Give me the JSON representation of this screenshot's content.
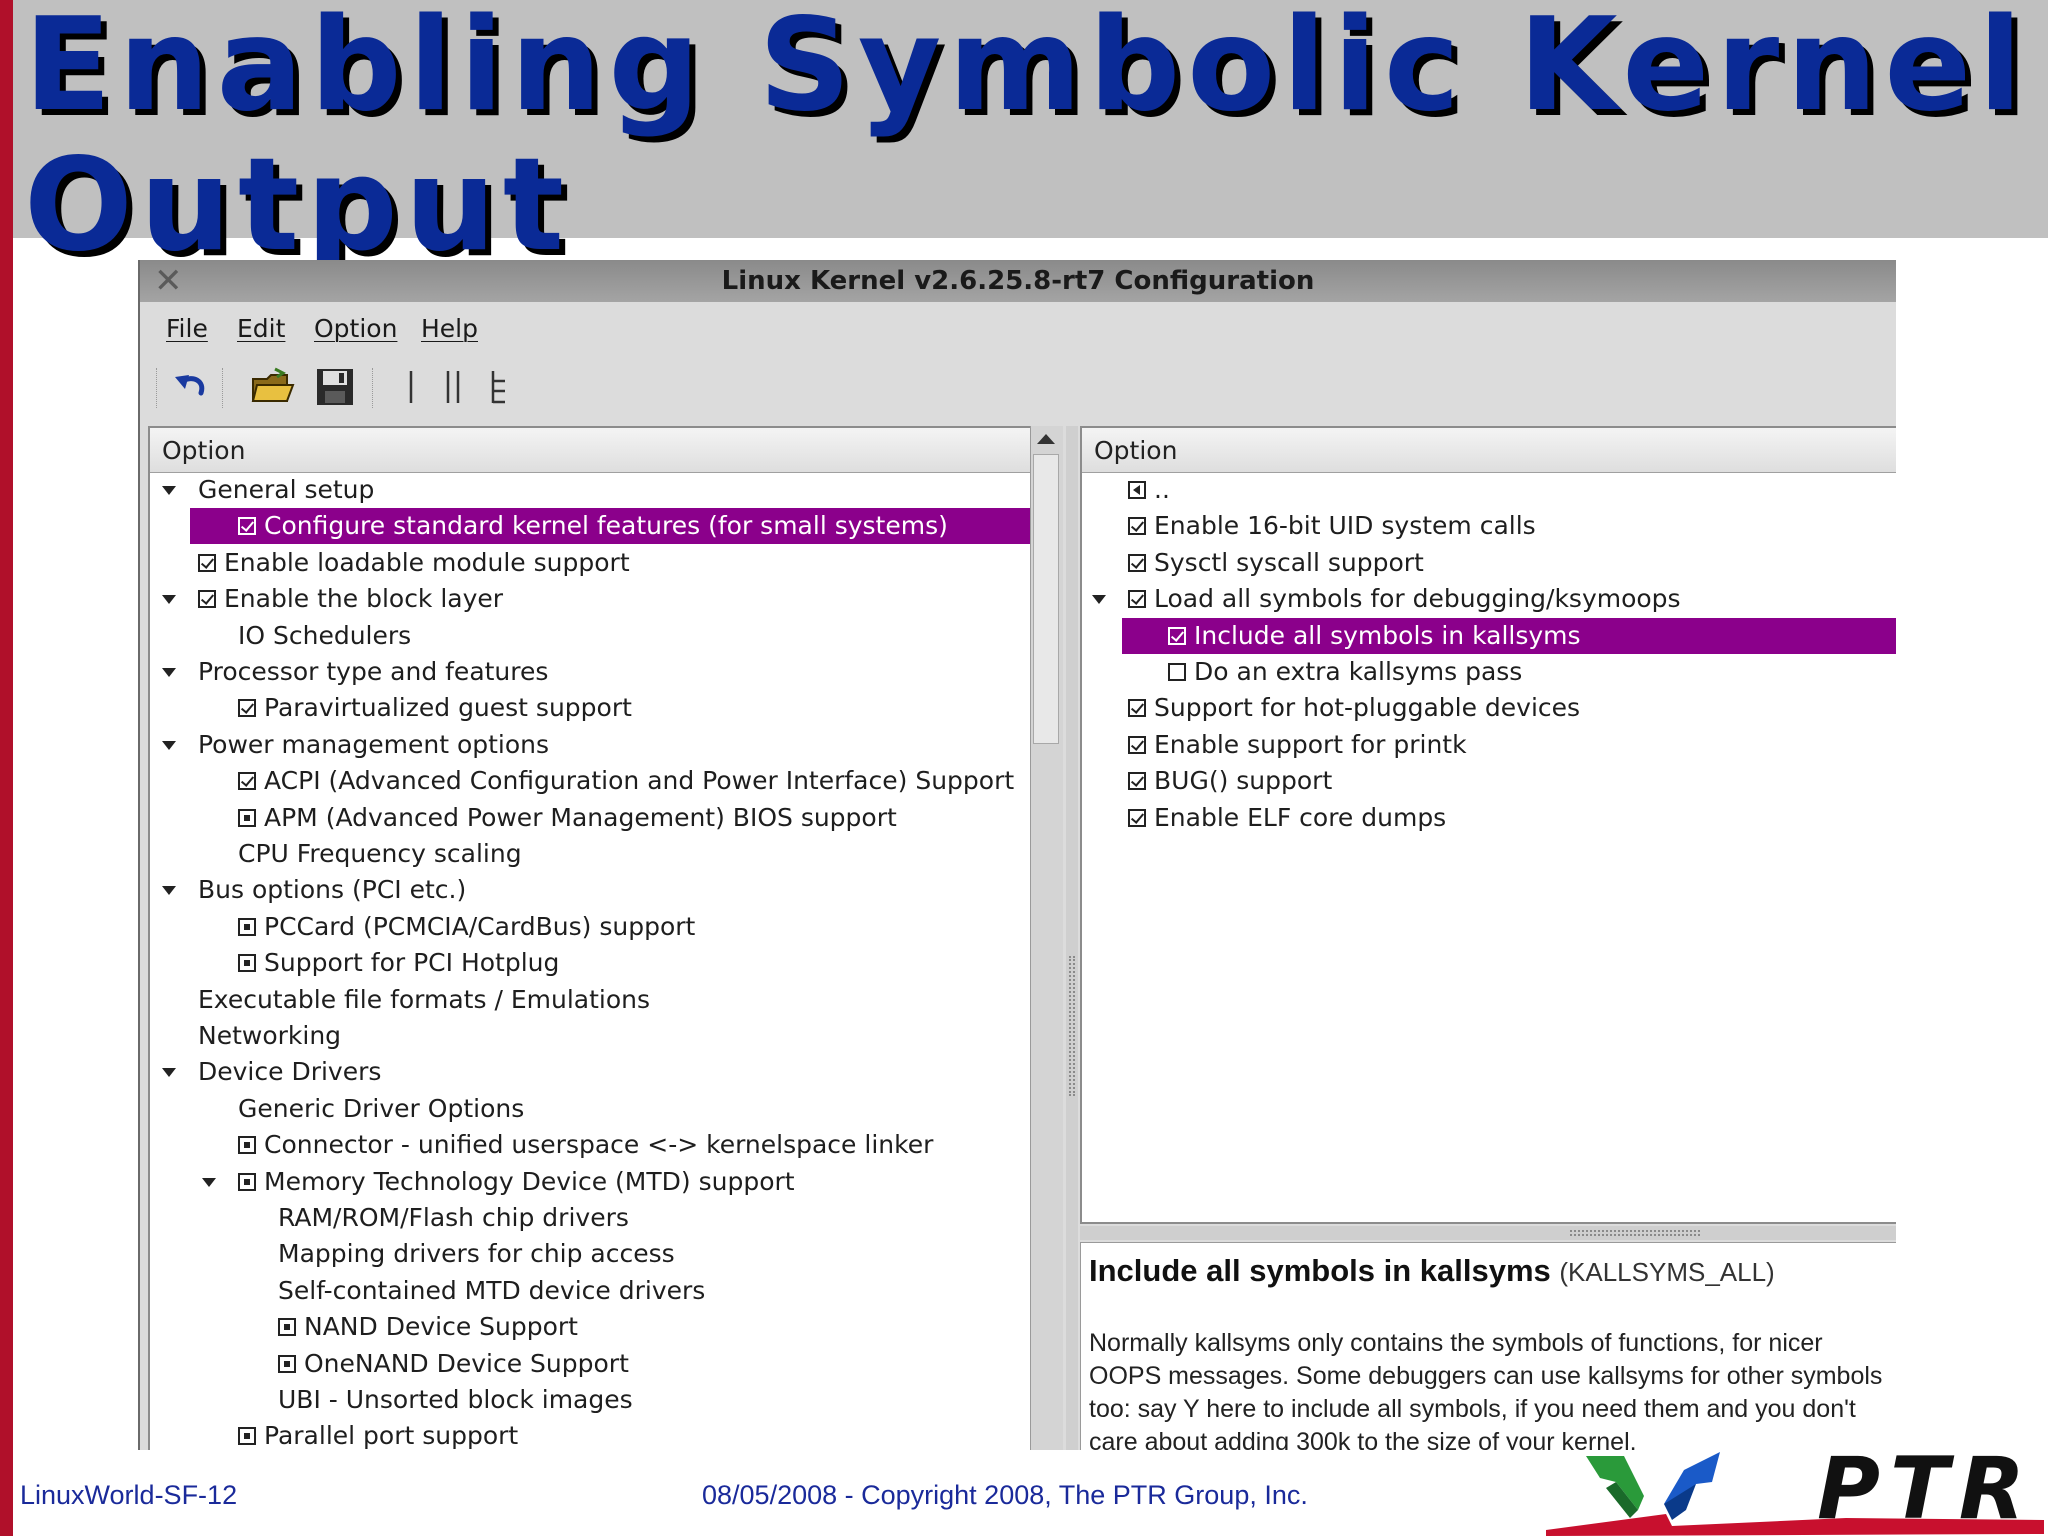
{
  "slide": {
    "title_line1": "Enabling Symbolic Kernel",
    "title_line2": "Output"
  },
  "window": {
    "title": "Linux Kernel v2.6.25.8-rt7 Configuration",
    "menu": [
      "File",
      "Edit",
      "Option",
      "Help"
    ],
    "toolbar": [
      "undo-icon",
      "open-folder-icon",
      "save-icon",
      "single-view-icon",
      "split-view-icon",
      "full-tree-view-icon"
    ]
  },
  "left_pane": {
    "header": "Option",
    "rows": [
      {
        "label": "General setup",
        "arrow": true,
        "mark": "none",
        "level": 0
      },
      {
        "label": "Configure standard kernel features (for small systems)",
        "arrow": false,
        "mark": "check",
        "level": 1,
        "selected": true
      },
      {
        "label": "Enable loadable module support",
        "arrow": false,
        "mark": "check",
        "level": 0
      },
      {
        "label": "Enable the block layer",
        "arrow": true,
        "mark": "check",
        "level": 0
      },
      {
        "label": "IO Schedulers",
        "arrow": false,
        "mark": "none",
        "level": 1
      },
      {
        "label": "Processor type and features",
        "arrow": true,
        "mark": "none",
        "level": 0
      },
      {
        "label": "Paravirtualized guest support",
        "arrow": false,
        "mark": "check",
        "level": 1
      },
      {
        "label": "Power management options",
        "arrow": true,
        "mark": "none",
        "level": 0
      },
      {
        "label": "ACPI (Advanced Configuration and Power Interface) Support",
        "arrow": false,
        "mark": "check",
        "level": 1
      },
      {
        "label": "APM (Advanced Power Management) BIOS support",
        "arrow": false,
        "mark": "module",
        "level": 1
      },
      {
        "label": "CPU Frequency scaling",
        "arrow": false,
        "mark": "none",
        "level": 1
      },
      {
        "label": "Bus options (PCI etc.)",
        "arrow": true,
        "mark": "none",
        "level": 0
      },
      {
        "label": "PCCard (PCMCIA/CardBus) support",
        "arrow": false,
        "mark": "module",
        "level": 1
      },
      {
        "label": "Support for PCI Hotplug",
        "arrow": false,
        "mark": "module",
        "level": 1
      },
      {
        "label": "Executable file formats / Emulations",
        "arrow": false,
        "mark": "none",
        "level": 0
      },
      {
        "label": "Networking",
        "arrow": false,
        "mark": "none",
        "level": 0
      },
      {
        "label": "Device Drivers",
        "arrow": true,
        "mark": "none",
        "level": 0
      },
      {
        "label": "Generic Driver Options",
        "arrow": false,
        "mark": "none",
        "level": 1
      },
      {
        "label": "Connector - unified userspace <-> kernelspace linker",
        "arrow": false,
        "mark": "module",
        "level": 1
      },
      {
        "label": "Memory Technology Device (MTD) support",
        "arrow": true,
        "mark": "module",
        "level": 1
      },
      {
        "label": "RAM/ROM/Flash chip drivers",
        "arrow": false,
        "mark": "none",
        "level": 2
      },
      {
        "label": "Mapping drivers for chip access",
        "arrow": false,
        "mark": "none",
        "level": 2
      },
      {
        "label": "Self-contained MTD device drivers",
        "arrow": false,
        "mark": "none",
        "level": 2
      },
      {
        "label": "NAND Device Support",
        "arrow": false,
        "mark": "module",
        "level": 2
      },
      {
        "label": "OneNAND Device Support",
        "arrow": false,
        "mark": "module",
        "level": 2
      },
      {
        "label": "UBI - Unsorted block images",
        "arrow": false,
        "mark": "none",
        "level": 2
      },
      {
        "label": "Parallel port support",
        "arrow": false,
        "mark": "module",
        "level": 1
      }
    ]
  },
  "right_pane": {
    "header": "Option",
    "rows": [
      {
        "label": "..",
        "arrow": false,
        "mark": "back",
        "level": 0
      },
      {
        "label": "Enable 16-bit UID system calls",
        "arrow": false,
        "mark": "check",
        "level": 0
      },
      {
        "label": "Sysctl syscall support",
        "arrow": false,
        "mark": "check",
        "level": 0
      },
      {
        "label": "Load all symbols for debugging/ksymoops",
        "arrow": true,
        "mark": "check",
        "level": 0
      },
      {
        "label": "Include all symbols in kallsyms",
        "arrow": false,
        "mark": "check",
        "level": 1,
        "selected": true
      },
      {
        "label": "Do an extra kallsyms pass",
        "arrow": false,
        "mark": "empty",
        "level": 1
      },
      {
        "label": "Support for hot-pluggable devices",
        "arrow": false,
        "mark": "check",
        "level": 0
      },
      {
        "label": "Enable support for printk",
        "arrow": false,
        "mark": "check",
        "level": 0
      },
      {
        "label": "BUG() support",
        "arrow": false,
        "mark": "check",
        "level": 0
      },
      {
        "label": "Enable ELF core dumps",
        "arrow": false,
        "mark": "check",
        "level": 0
      }
    ]
  },
  "help": {
    "title": "Include all symbols in kallsyms",
    "symbol": "(KALLSYMS_ALL)",
    "body": "Normally kallsyms only contains the symbols of functions, for nicer OOPS messages. Some debuggers can use kallsyms for other symbols too: say Y here to include all symbols, if you need them and you don't care about adding 300k to the size of your kernel."
  },
  "footer": {
    "left": "LinuxWorld-SF-12",
    "center": "08/05/2008 - Copyright 2008, The PTR Group, Inc.",
    "logo_text": "PTR"
  },
  "colors": {
    "title_blue": "#0a2a96",
    "selection": "#8b008b",
    "accent_red": "#b0102a",
    "footer_blue": "#1a2a9a"
  }
}
